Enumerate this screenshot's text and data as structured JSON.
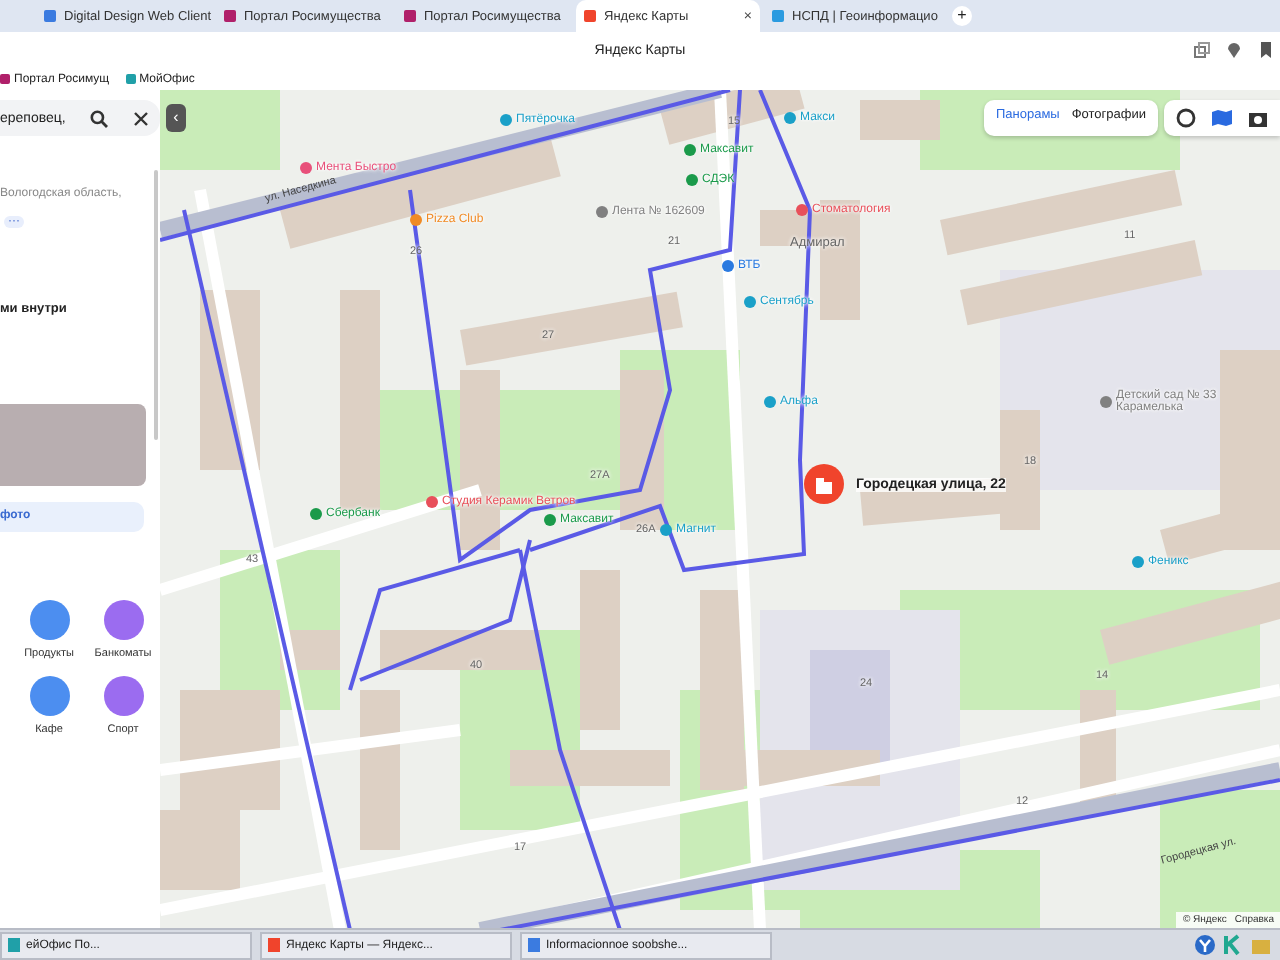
{
  "browser": {
    "tabs": [
      {
        "title": "Digital Design Web Client",
        "selected": false,
        "color": "#3b7be0"
      },
      {
        "title": "Портал Росимущества",
        "selected": false,
        "color": "#b0206a"
      },
      {
        "title": "Портал Росимущества",
        "selected": false,
        "color": "#b0206a"
      },
      {
        "title": "Яндекс Карты",
        "selected": true,
        "color": "#f0442c"
      },
      {
        "title": "НСПД | Геоинформацио",
        "selected": false,
        "color": "#2b9be0"
      }
    ],
    "close_tab": "×",
    "new_tab": "+",
    "window_title": "Яндекс Карты",
    "bookmarks": [
      {
        "title": "Портал Росимущ",
        "color": "#b0206a"
      },
      {
        "title": "МойОфис",
        "color": "#20a0a8"
      }
    ]
  },
  "sidebar": {
    "search": {
      "value": "ереповец,"
    },
    "address": "Вологодская область,",
    "more": "···",
    "heading": "ми внутри",
    "photo_button": "фото",
    "categories": [
      {
        "label": "Продукты",
        "color": "#4c8ef0"
      },
      {
        "label": "Банкоматы",
        "color": "#9b6cf0"
      },
      {
        "label": "Кафе",
        "color": "#4c8ef0"
      },
      {
        "label": "Спорт",
        "color": "#9b6cf0"
      }
    ]
  },
  "map": {
    "collapse": "‹",
    "layer_buttons": [
      {
        "label": "Панорамы",
        "selected": true
      },
      {
        "label": "Фотографии",
        "selected": false
      }
    ],
    "places": [
      {
        "name": "Пятёрочка",
        "color": "#1aa0c8"
      },
      {
        "name": "Максавит",
        "color": "#1a9a4a"
      },
      {
        "name": "Макси",
        "color": "#1aa0c8"
      },
      {
        "name": "Мента Быстро",
        "color": "#e8507a"
      },
      {
        "name": "СДЭК",
        "color": "#1a9a4a"
      },
      {
        "name": "Pizza Club",
        "color": "#f08a24"
      },
      {
        "name": "Лента № 162609",
        "color": "#808080"
      },
      {
        "name": "Стоматология",
        "color": "#e8505a"
      },
      {
        "name": "ВТБ",
        "color": "#2a7ae0"
      },
      {
        "name": "Сентябрь",
        "color": "#1aa0c8"
      },
      {
        "name": "Альфа",
        "color": "#1aa0c8"
      },
      {
        "name": "Сбербанк",
        "color": "#1a9a4a"
      },
      {
        "name": "Студия Керамик Ветров",
        "color": "#e8505a"
      },
      {
        "name": "Максавит",
        "color": "#1a9a4a"
      },
      {
        "name": "Магнит",
        "color": "#1aa0c8"
      },
      {
        "name": "Феникс",
        "color": "#1aa0c8"
      },
      {
        "name": "Детский сад № 33 Карамелька",
        "color": "#808080"
      }
    ],
    "areas": [
      "Адмирал"
    ],
    "streets": [
      "ул. Наседкина",
      "Городецкая ул."
    ],
    "house_numbers": [
      "15",
      "11",
      "21",
      "26",
      "27",
      "27А",
      "18",
      "26А",
      "43",
      "24",
      "14",
      "12",
      "17",
      "40"
    ],
    "selected_place": "Городецкая улица, 22",
    "footer": [
      "© Яндекс",
      "Справка"
    ]
  },
  "taskbar": {
    "items": [
      {
        "title": "ейОфис По...",
        "color": "#20a0a8"
      },
      {
        "title": "Яндекс Карты — Яндекс...",
        "color": "#f0442c"
      },
      {
        "title": "Informacionnoe soobshe...",
        "color": "#3b7be0"
      }
    ]
  }
}
